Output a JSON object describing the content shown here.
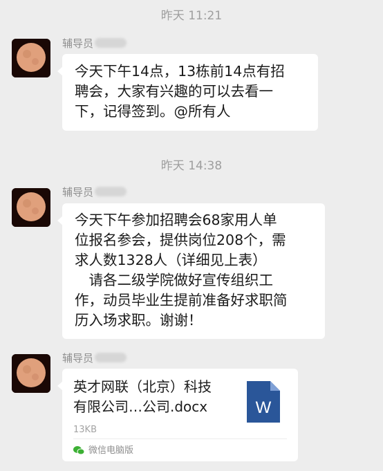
{
  "messages": [
    {
      "timestamp": "昨天 11:21",
      "sender": "辅导员",
      "lines": [
        "今天下午14点，13栋前14点有招",
        "聘会，大家有兴趣的可以去看一",
        "下，记得签到。@所有人"
      ]
    },
    {
      "timestamp": "昨天 14:38",
      "sender": "辅导员",
      "lines": [
        "今天下午参加招聘会68家用人单",
        "位报名参会，提供岗位208个，需",
        "求人数1328人（详细见上表）",
        "　请各二级学院做好宣传组织工",
        "作，动员毕业生提前准备好求职简",
        "历入场求职。谢谢！"
      ]
    },
    {
      "sender": "辅导员",
      "file": {
        "name_line1": "英才网联（北京）科技",
        "name_line2": "有限公司…公司.docx",
        "size": "13KB",
        "icon_letter": "W",
        "icon": "word-doc-icon",
        "icon_color": "#2a5699",
        "source": "微信电脑版"
      }
    }
  ],
  "colors": {
    "background": "#ededed",
    "bubble": "#ffffff",
    "timestamp_text": "#9e9e9e",
    "wechat_green": "#3cb034"
  }
}
